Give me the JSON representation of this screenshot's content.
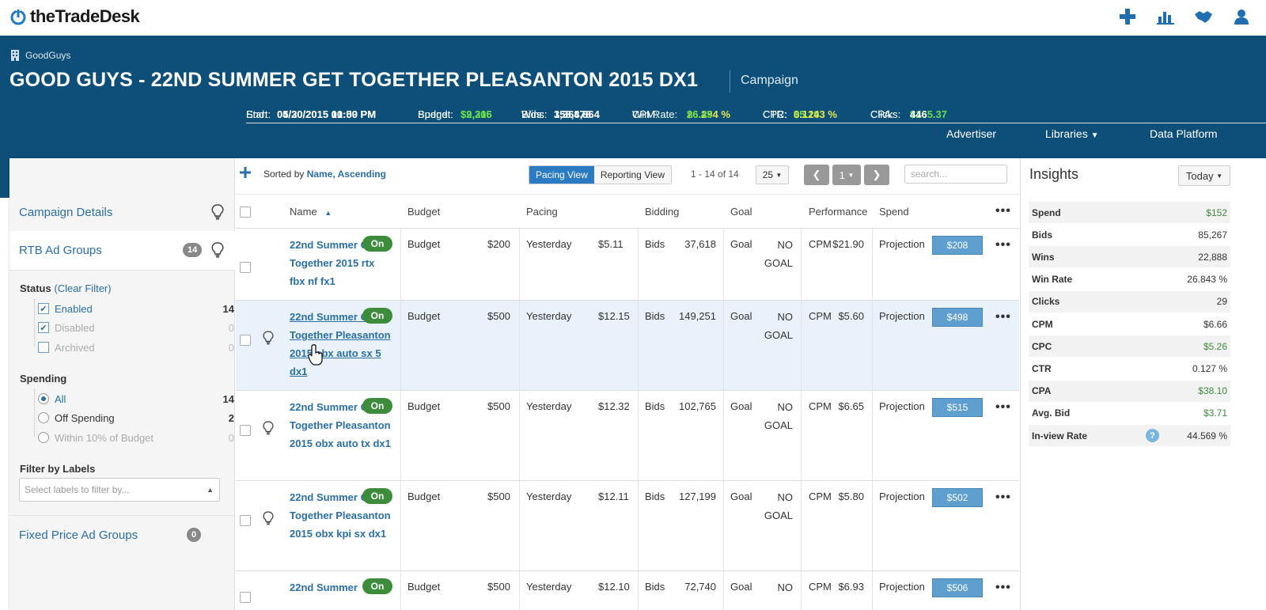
{
  "app": {
    "logo_text": "theTradeDesk"
  },
  "topbar": {
    "icons": [
      "plus-icon",
      "chart-icon",
      "handshake-icon",
      "user-icon"
    ]
  },
  "header": {
    "advertiser": "GoodGuys",
    "title": "GOOD GUYS - 22ND SUMMER GET TOGETHER PLEASANTON 2015 DX1",
    "tag": "Campaign",
    "start_label": "Start:",
    "start_value": "04/20/2015 01:00 PM",
    "end_label": "End:",
    "end_value": "05/30/2015 10:59 PM",
    "budget_label": "Budget:",
    "budget_value": "$9,206",
    "spend_label": "Spend:",
    "spend_value": "$2,315",
    "bids_label": "Bids:",
    "bids_value": "1,364,864",
    "wins_label": "Wins:",
    "wins_value": "358,878",
    "winrate_label": "Win Rate:",
    "winrate_value": "26.294 %",
    "cpm_label": "CPM:",
    "cpm_value": "$6.45",
    "cpc_label": "CPC:",
    "cpc_value": "$5.19",
    "ctr_label": "CTR:",
    "ctr_value": "0.1243 %",
    "cpa_label": "CPA:",
    "cpa_value": "$165.37",
    "clicks_label": "Clicks:",
    "clicks_value": "446",
    "nav": {
      "advertiser": "Advertiser",
      "libraries": "Libraries",
      "data_platform": "Data Platform"
    }
  },
  "sidebar": {
    "campaign_details": "Campaign Details",
    "rtb_ad_groups": "RTB Ad Groups",
    "rtb_count": "14",
    "status_label": "Status",
    "clear_filter": "(Clear Filter)",
    "status": [
      {
        "label": "Enabled",
        "count": "14"
      },
      {
        "label": "Disabled",
        "count": "0"
      },
      {
        "label": "Archived",
        "count": "0"
      }
    ],
    "spending_label": "Spending",
    "spending": [
      {
        "label": "All",
        "count": "14"
      },
      {
        "label": "Off Spending",
        "count": "2"
      },
      {
        "label": "Within 10% of Budget",
        "count": "0"
      }
    ],
    "filter_labels": "Filter by Labels",
    "filter_placeholder": "Select labels to filter by...",
    "fixed_price": "Fixed Price Ad Groups",
    "fixed_count": "0"
  },
  "toolbar": {
    "sorted_by": "Sorted by",
    "sort_value": "Name, Ascending",
    "pacing_view": "Pacing View",
    "reporting_view": "Reporting View",
    "range": "1 - 14 of 14",
    "per_page": "25",
    "page": "1",
    "search_placeholder": "search..."
  },
  "columns": [
    "Name",
    "Budget",
    "Pacing",
    "Bidding",
    "Goal",
    "Performance",
    "Spend"
  ],
  "rows": [
    {
      "name": "22nd Summer Get Together 2015 rtx fbx nf fx1",
      "status": "On",
      "budget_label": "Budget",
      "budget": "$200",
      "pacing_label": "Yesterday",
      "pacing": "$5.11",
      "bids_label": "Bids",
      "bids": "37,618",
      "goal_label": "Goal",
      "goal": "NO GOAL",
      "perf_label": "CPM",
      "perf": "$21.90",
      "spend_label": "Projection",
      "spend": "$208"
    },
    {
      "name": "22nd Summer Get Together Pleasanton 2015 obx auto sx 5 dx1",
      "status": "On",
      "budget_label": "Budget",
      "budget": "$500",
      "pacing_label": "Yesterday",
      "pacing": "$12.15",
      "bids_label": "Bids",
      "bids": "149,251",
      "goal_label": "Goal",
      "goal": "NO GOAL",
      "perf_label": "CPM",
      "perf": "$5.60",
      "spend_label": "Projection",
      "spend": "$498"
    },
    {
      "name": "22nd Summer Get Together Pleasanton 2015 obx auto tx dx1",
      "status": "On",
      "budget_label": "Budget",
      "budget": "$500",
      "pacing_label": "Yesterday",
      "pacing": "$12.32",
      "bids_label": "Bids",
      "bids": "102,765",
      "goal_label": "Goal",
      "goal": "NO GOAL",
      "perf_label": "CPM",
      "perf": "$6.65",
      "spend_label": "Projection",
      "spend": "$515"
    },
    {
      "name": "22nd Summer Get Together Pleasanton 2015 obx kpi sx dx1",
      "status": "On",
      "budget_label": "Budget",
      "budget": "$500",
      "pacing_label": "Yesterday",
      "pacing": "$12.11",
      "bids_label": "Bids",
      "bids": "127,199",
      "goal_label": "Goal",
      "goal": "NO GOAL",
      "perf_label": "CPM",
      "perf": "$5.80",
      "spend_label": "Projection",
      "spend": "$502"
    },
    {
      "name": "22nd Summer",
      "status": "On",
      "budget_label": "Budget",
      "budget": "$500",
      "pacing_label": "Yesterday",
      "pacing": "$12.10",
      "bids_label": "Bids",
      "bids": "72,740",
      "goal_label": "Goal",
      "goal": "NO",
      "perf_label": "CPM",
      "perf": "$6.93",
      "spend_label": "Projection",
      "spend": "$506"
    }
  ],
  "insights": {
    "title": "Insights",
    "period": "Today",
    "rows": [
      {
        "label": "Spend",
        "value": "$152"
      },
      {
        "label": "Bids",
        "value": "85,267"
      },
      {
        "label": "Wins",
        "value": "22,888"
      },
      {
        "label": "Win Rate",
        "value": "26.843 %"
      },
      {
        "label": "Clicks",
        "value": "29"
      },
      {
        "label": "CPM",
        "value": "$6.66"
      },
      {
        "label": "CPC",
        "value": "$5.26"
      },
      {
        "label": "CTR",
        "value": "0.127 %"
      },
      {
        "label": "CPA",
        "value": "$38.10"
      },
      {
        "label": "Avg. Bid",
        "value": "$3.71"
      },
      {
        "label": "In-view Rate",
        "value": "44.569 %"
      }
    ]
  },
  "colors": {
    "header_bg": "#0e4f7a",
    "accent": "#2a6fa5",
    "green": "#3c8c3c",
    "highlight": "#6bdc4c",
    "yellow": "#e8e84a"
  }
}
